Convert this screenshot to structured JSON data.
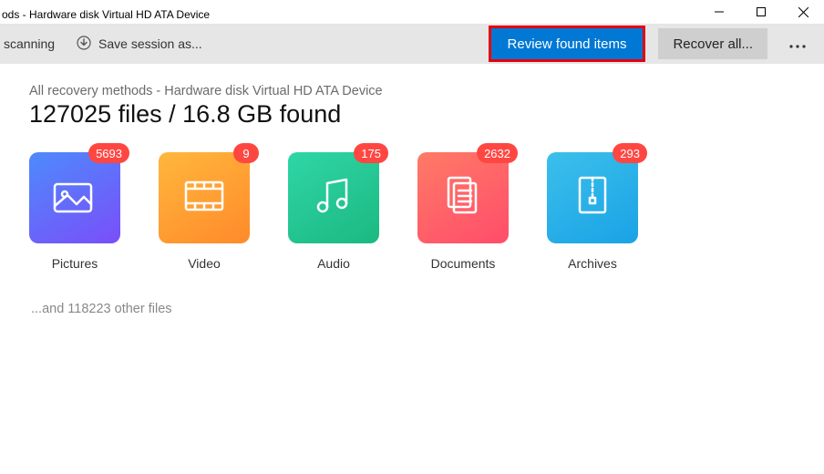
{
  "window": {
    "title": "ods - Hardware disk Virtual HD ATA Device"
  },
  "toolbar": {
    "scanning_label": "scanning",
    "save_session_label": "Save session as...",
    "review_label": "Review found items",
    "recover_label": "Recover all..."
  },
  "main": {
    "breadcrumb": "All recovery methods - Hardware disk Virtual HD ATA Device",
    "summary": "127025 files / 16.8 GB found",
    "other_files": "...and 118223 other files"
  },
  "categories": [
    {
      "label": "Pictures",
      "count": "5693"
    },
    {
      "label": "Video",
      "count": "9"
    },
    {
      "label": "Audio",
      "count": "175"
    },
    {
      "label": "Documents",
      "count": "2632"
    },
    {
      "label": "Archives",
      "count": "293"
    }
  ]
}
